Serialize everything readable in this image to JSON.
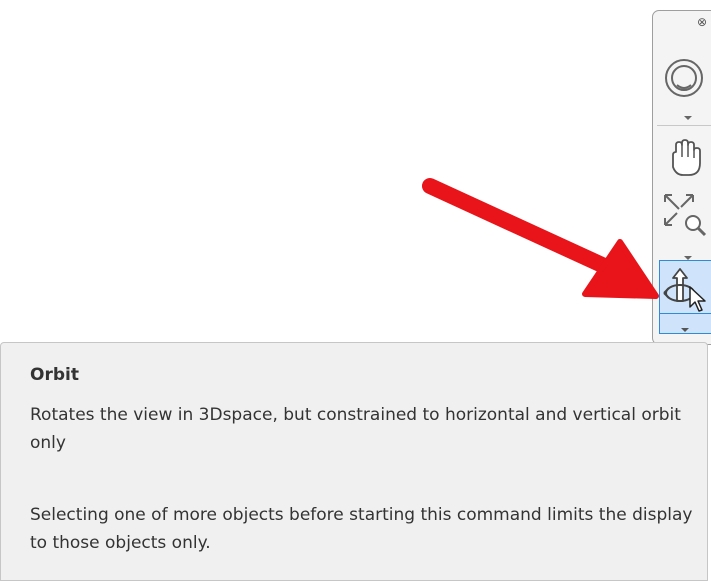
{
  "navigation_bar": {
    "close_glyph": "⊗",
    "tools": [
      {
        "name": "steering-wheel",
        "icon": "steering-wheel-icon",
        "has_dropdown": true
      },
      {
        "name": "pan",
        "icon": "hand-icon",
        "has_dropdown": false
      },
      {
        "name": "zoom",
        "icon": "zoom-extents-icon",
        "has_dropdown": true
      },
      {
        "name": "orbit",
        "icon": "orbit-icon",
        "has_dropdown": true,
        "highlighted": true
      }
    ],
    "highlight_color": "#cfe4fa",
    "highlight_border": "#2e8bd9"
  },
  "annotation": {
    "arrow_color": "#e8141a"
  },
  "tooltip": {
    "title": "Orbit",
    "description": "Rotates the view in 3Dspace, but constrained to horizontal and vertical orbit only",
    "extended_help": "Selecting one of more objects before starting this command limits the display to those objects only."
  }
}
